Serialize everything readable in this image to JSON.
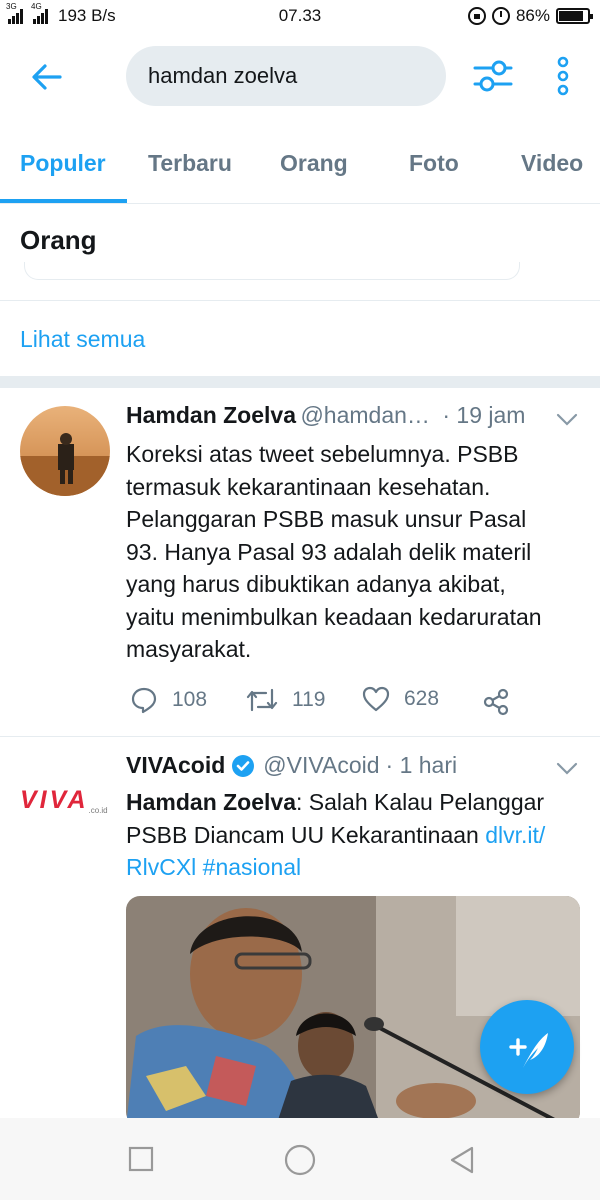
{
  "status_bar": {
    "network_left": "3G",
    "network_right": "4G",
    "speed": "193 B/s",
    "time": "07.33",
    "battery": "86%",
    "battery_level": 0.86
  },
  "header": {
    "search_query": "hamdan zoelva"
  },
  "tabs": [
    {
      "label": "Populer",
      "active": true
    },
    {
      "label": "Terbaru",
      "active": false
    },
    {
      "label": "Orang",
      "active": false
    },
    {
      "label": "Foto",
      "active": false
    },
    {
      "label": "Video",
      "active": false
    }
  ],
  "people_section": {
    "title": "Orang",
    "see_all": "Lihat semua"
  },
  "tweets": [
    {
      "name": "Hamdan Zoelva",
      "handle": "@hamdan…",
      "time": "· 19 jam",
      "text_lines": [
        "Koreksi atas tweet sebelumnya. PSBB",
        "termasuk kekarantinaan kesehatan.",
        "Pelanggaran PSBB masuk unsur Pasal",
        "93. Hanya Pasal 93 adalah delik materil",
        "yang harus dibuktikan adanya akibat,",
        "yaitu menimbulkan keadaan kedaruratan",
        "masyarakat."
      ],
      "replies": "108",
      "retweets": "119",
      "likes": "628"
    },
    {
      "name": "VIVAcoid",
      "verified": true,
      "handle": "@VIVAcoid",
      "time": "· 1 hari",
      "bold_lead": "Hamdan Zoelva",
      "text_line1_rest": ": Salah Kalau Pelanggar",
      "text_line2_plain": "PSBB Diancam UU Kekarantinaan ",
      "text_line2_link": "dlvr.it/",
      "text_line3_link": "RlvCXl #nasional",
      "logo_text": "VIVA",
      "logo_suffix": ".co.id"
    }
  ],
  "colors": {
    "accent": "#1da1f2",
    "secondary_text": "#657786",
    "divider": "#e6ecf0"
  },
  "icons": [
    "back-arrow-icon",
    "filter-sliders-icon",
    "more-vertical-icon",
    "reply-icon",
    "retweet-icon",
    "like-icon",
    "share-icon",
    "chevron-down-icon",
    "verified-icon",
    "compose-tweet-icon",
    "recent-apps-icon",
    "home-icon",
    "back-icon"
  ]
}
